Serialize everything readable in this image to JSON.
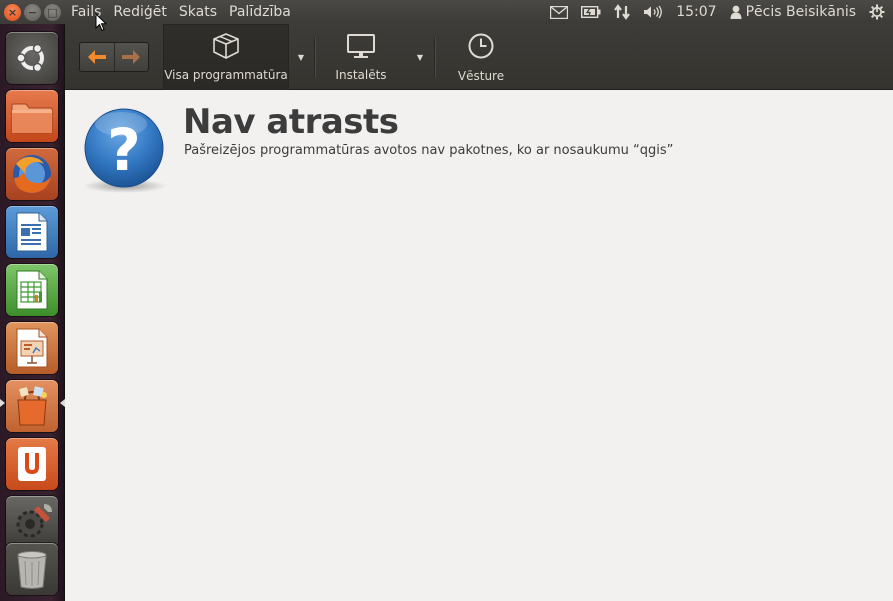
{
  "window_controls": {
    "close": "×",
    "minimize": "−",
    "maximize": "□"
  },
  "menu": [
    "Fails",
    "Rediģēt",
    "Skats",
    "Palīdzība"
  ],
  "indicators": {
    "mail_icon": "envelope-icon",
    "battery_icon": "battery-icon",
    "network_icon": "network-updown-icon",
    "sound_icon": "speaker-icon",
    "clock": "15:07",
    "user_icon": "person-icon",
    "user_name": "Pēcis Beisikānis",
    "session_icon": "gear-power-icon"
  },
  "launcher": [
    {
      "name": "launcher-ubuntu",
      "icon": "ubuntu-logo-icon"
    },
    {
      "name": "launcher-files",
      "icon": "folder-icon"
    },
    {
      "name": "launcher-firefox",
      "icon": "firefox-icon"
    },
    {
      "name": "launcher-writer",
      "icon": "libreoffice-writer-icon"
    },
    {
      "name": "launcher-calc",
      "icon": "libreoffice-calc-icon"
    },
    {
      "name": "launcher-impress",
      "icon": "libreoffice-impress-icon"
    },
    {
      "name": "launcher-software-center",
      "icon": "software-center-bag-icon"
    },
    {
      "name": "launcher-ubuntu-one",
      "icon": "ubuntu-one-icon"
    },
    {
      "name": "launcher-system-settings",
      "icon": "system-settings-icon"
    },
    {
      "name": "launcher-trash",
      "icon": "trash-icon"
    }
  ],
  "toolbar": {
    "back_icon": "back-arrow-icon",
    "forward_icon": "forward-arrow-icon",
    "all_software_label": "Visa programmatūra",
    "installed_label": "Instalēts",
    "history_label": "Vēsture",
    "dropdown_glyph": "▼"
  },
  "content": {
    "title": "Nav atrasts",
    "description": "Pašreizējos programmatūras avotos nav pakotnes, ko ar nosaukumu “qgis”",
    "help_glyph": "?"
  },
  "colors": {
    "panel": "#3c3b37",
    "content_bg": "#f2f1f0",
    "accent_orange": "#dd4814",
    "text_dark": "#3c3c3c",
    "help_blue": "#2f74c0"
  }
}
